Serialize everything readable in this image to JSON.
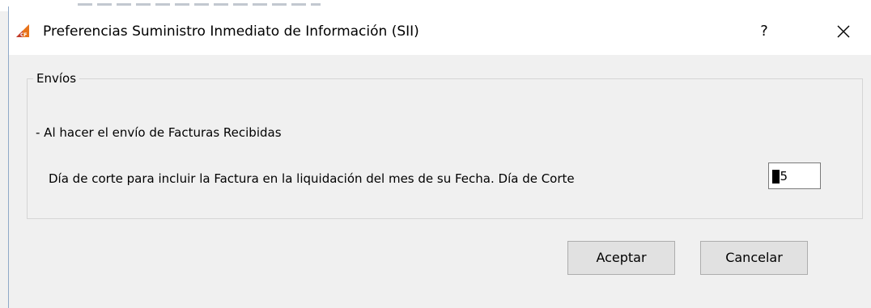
{
  "dialog": {
    "title": "Preferencias Suministro Inmediato de Información (SII)",
    "help_label": "?",
    "app_icon": "cf-app-icon",
    "close_icon": "close-icon"
  },
  "group": {
    "legend": "Envíos",
    "line1": "- Al hacer el envío de Facturas Recibidas",
    "line2": "Día de corte para incluir la Factura en la liquidación del mes de su Fecha. Día de Corte",
    "day_value": "15"
  },
  "buttons": {
    "accept": "Aceptar",
    "cancel": "Cancelar"
  },
  "colors": {
    "icon_orange": "#e8731a",
    "icon_red": "#c0392b",
    "border_blue": "#8fa9c8"
  }
}
